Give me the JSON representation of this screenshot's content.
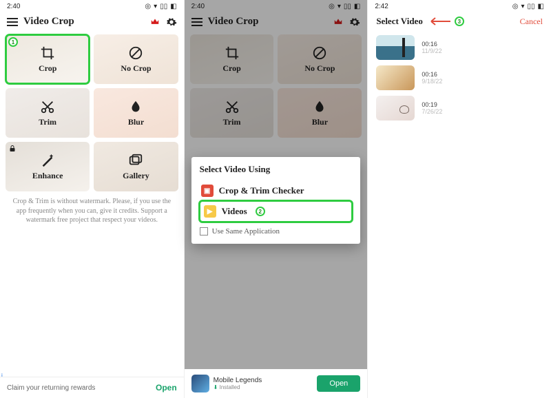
{
  "screen1": {
    "time": "2:40",
    "app_title": "Video Crop",
    "tiles": [
      {
        "label": "Crop",
        "highlight": true,
        "badge": "1"
      },
      {
        "label": "No Crop"
      },
      {
        "label": "Trim"
      },
      {
        "label": "Blur"
      },
      {
        "label": "Enhance",
        "locked": true
      },
      {
        "label": "Gallery"
      }
    ],
    "note": "Crop & Trim is without watermark. Please, if you use the app frequently when you can, give it credits. Support a watermark free project that respect your videos.",
    "ad": {
      "text": "Claim your returning rewards",
      "cta": "Open"
    }
  },
  "screen2": {
    "time": "2:40",
    "app_title": "Video Crop",
    "tiles": [
      "Crop",
      "No Crop",
      "Trim",
      "Blur"
    ],
    "dialog": {
      "title": "Select Video Using",
      "rows": [
        {
          "label": "Crop & Trim Checker",
          "icon": "red"
        },
        {
          "label": "Videos",
          "icon": "yellow",
          "highlight": true,
          "badge": "2"
        }
      ],
      "checkbox_label": "Use Same Application"
    },
    "ad": {
      "title": "Mobile Legends",
      "sub": "Installed",
      "cta": "Open"
    }
  },
  "screen3": {
    "time": "2:42",
    "title": "Select Video",
    "badge": "3",
    "cancel": "Cancel",
    "videos": [
      {
        "dur": "00:16",
        "date": "11/9/22"
      },
      {
        "dur": "00:16",
        "date": "9/18/22"
      },
      {
        "dur": "00:19",
        "date": "7/26/22"
      }
    ]
  },
  "icons": {
    "info": "i",
    "close": "✕"
  }
}
